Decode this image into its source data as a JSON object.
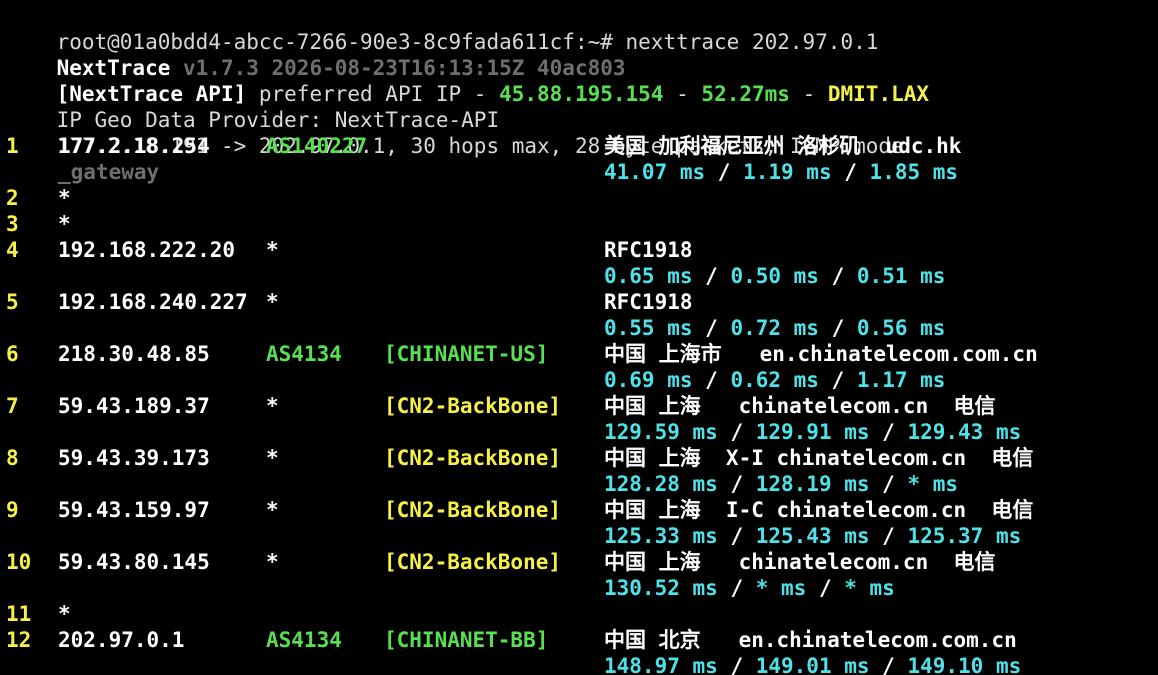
{
  "header": {
    "prompt": "root@01a0bdd4-abcc-7266-90e3-8c9fada611cf:~# nexttrace 202.97.0.1",
    "app_name": "NextTrace",
    "version_info": " v1.7.3 2026-08-23T16:13:15Z 40ac803",
    "api_label": "[NextTrace API]",
    "api_text": " preferred API IP - ",
    "api_ip": "45.88.195.154",
    "sep1": " - ",
    "api_latency": "52.27ms",
    "sep2": " - ",
    "api_node": "DMIT.LAX",
    "geo_provider": "IP Geo Data Provider: NextTrace-API",
    "trace_summary": "177.2.18.191 -> 202.97.0.1, 30 hops max, 28 byte packets, ICMP mode"
  },
  "colors": {
    "hop_number": "#f5f04a",
    "as_number": "#59e052",
    "backbone": "#f5f04a",
    "latency": "#4fe1e8",
    "hostname_hint": "#6f6f6f"
  },
  "hops": [
    {
      "num": "1",
      "ip": "177.2.18.254",
      "asn": "AS140227",
      "geo": "美国 加利福尼亚州 洛杉矶  udc.hk",
      "hostname": "_gateway",
      "latency": {
        "v1": "41.07 ms",
        "v2": "1.19 ms",
        "v3": "1.85 ms"
      }
    },
    {
      "num": "2",
      "ip": "*"
    },
    {
      "num": "3",
      "ip": "*"
    },
    {
      "num": "4",
      "ip": "192.168.222.20",
      "asn": "*",
      "geo": "RFC1918",
      "latency": {
        "v1": "0.65 ms",
        "v2": "0.50 ms",
        "v3": "0.51 ms"
      }
    },
    {
      "num": "5",
      "ip": "192.168.240.227",
      "asn": "*",
      "geo": "RFC1918",
      "latency": {
        "v1": "0.55 ms",
        "v2": "0.72 ms",
        "v3": "0.56 ms"
      }
    },
    {
      "num": "6",
      "ip": "218.30.48.85",
      "asn": "AS4134",
      "tag": "[CHINANET-US]",
      "tag_color": "green",
      "geo": "中国 上海市   en.chinatelecom.com.cn",
      "latency": {
        "v1": "0.69 ms",
        "v2": "0.62 ms",
        "v3": "1.17 ms"
      }
    },
    {
      "num": "7",
      "ip": "59.43.189.37",
      "asn": "*",
      "tag": "[CN2-BackBone]",
      "tag_color": "yellow",
      "geo": "中国 上海   chinatelecom.cn  电信",
      "latency": {
        "v1": "129.59 ms",
        "v2": "129.91 ms",
        "v3": "129.43 ms"
      }
    },
    {
      "num": "8",
      "ip": "59.43.39.173",
      "asn": "*",
      "tag": "[CN2-BackBone]",
      "tag_color": "yellow",
      "geo": "中国 上海  X-I chinatelecom.cn  电信",
      "latency": {
        "v1": "128.28 ms",
        "v2": "128.19 ms",
        "v3": "* ms"
      }
    },
    {
      "num": "9",
      "ip": "59.43.159.97",
      "asn": "*",
      "tag": "[CN2-BackBone]",
      "tag_color": "yellow",
      "geo": "中国 上海  I-C chinatelecom.cn  电信",
      "latency": {
        "v1": "125.33 ms",
        "v2": "125.43 ms",
        "v3": "125.37 ms"
      }
    },
    {
      "num": "10",
      "ip": "59.43.80.145",
      "asn": "*",
      "tag": "[CN2-BackBone]",
      "tag_color": "yellow",
      "geo": "中国 上海   chinatelecom.cn  电信",
      "latency": {
        "v1": "130.52 ms",
        "v2": "* ms",
        "v3": "* ms"
      }
    },
    {
      "num": "11",
      "ip": "*"
    },
    {
      "num": "12",
      "ip": "202.97.0.1",
      "asn": "AS4134",
      "tag": "[CHINANET-BB]",
      "tag_color": "green",
      "geo": "中国 北京   en.chinatelecom.com.cn",
      "latency": {
        "v1": "148.97 ms",
        "v2": "149.01 ms",
        "v3": "149.10 ms"
      }
    }
  ],
  "latency_separator": " / "
}
